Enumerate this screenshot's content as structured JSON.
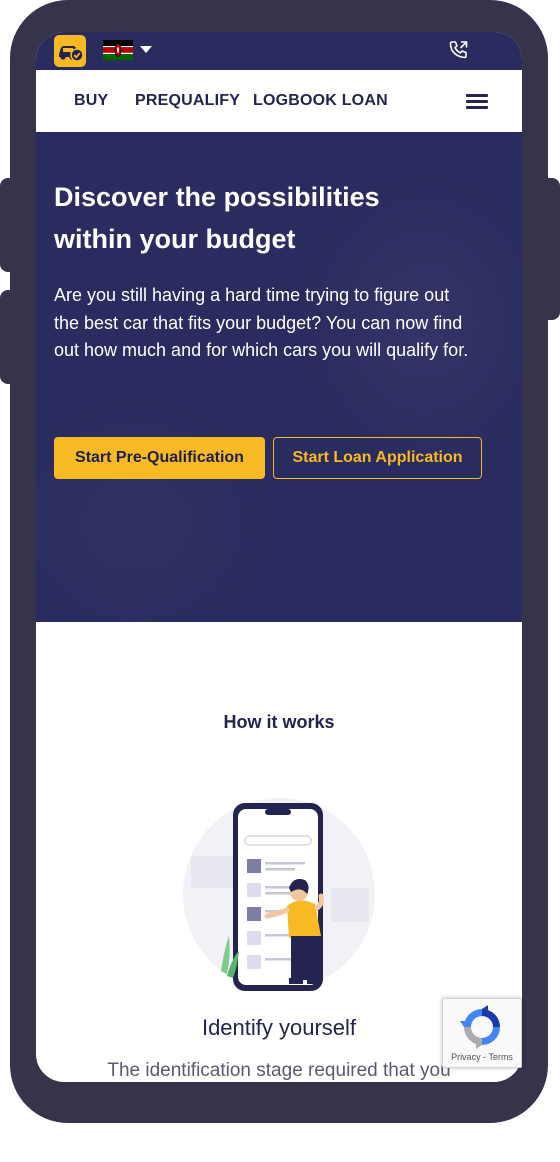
{
  "topbar": {
    "logo_icon": "car-check-icon",
    "flag_icon": "kenya-flag-icon",
    "language_dropdown_icon": "caret-down-icon",
    "call_icon": "phone-call-icon"
  },
  "nav": {
    "items": [
      {
        "label": "BUY"
      },
      {
        "label": "PREQUALIFY"
      },
      {
        "label": "LOGBOOK LOAN"
      }
    ],
    "menu_icon": "hamburger-menu-icon"
  },
  "hero": {
    "title_line1": "Discover the possibilities",
    "title_line2": "within your budget",
    "text_line1": "Are you still having a hard time trying to figure out",
    "text_line2": "the best car that fits your budget? You can now find",
    "text_line3": "out how much and for which cars you will qualify for.",
    "primary_button": "Start Pre-Qualification",
    "secondary_button": "Start Loan Application"
  },
  "how_it_works": {
    "title": "How it works",
    "step_title": "Identify yourself",
    "step_text": "The identification stage required that you"
  },
  "recaptcha": {
    "privacy": "Privacy",
    "separator": "-",
    "terms": "Terms"
  },
  "colors": {
    "brand_navy": "#2a2b5e",
    "accent_yellow": "#f7b924",
    "frame": "#35344a"
  }
}
